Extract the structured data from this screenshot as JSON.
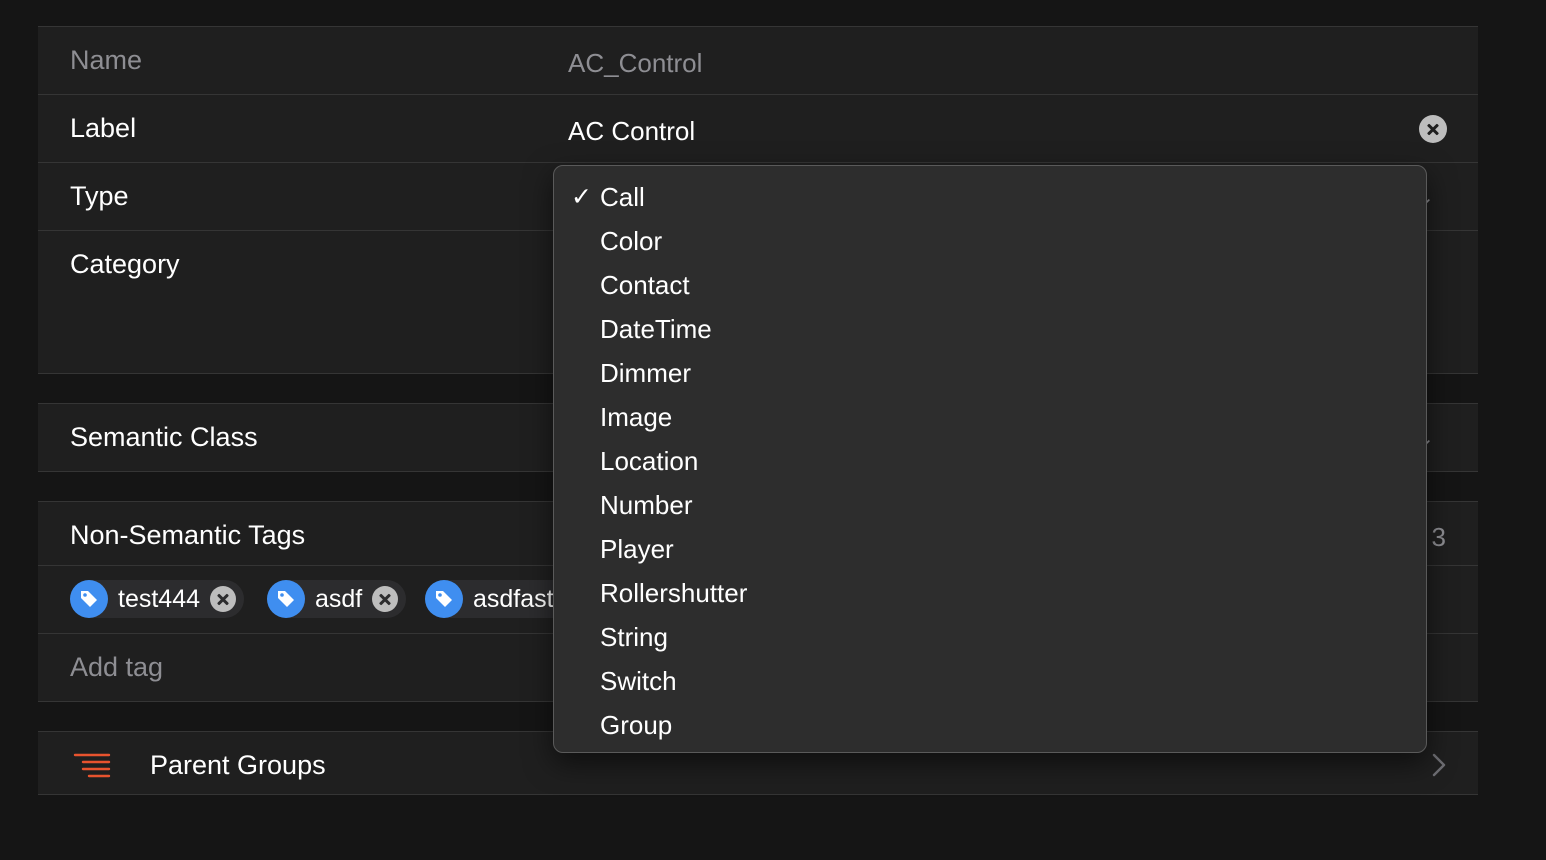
{
  "fields": {
    "name": {
      "label": "Name",
      "value": "AC_Control"
    },
    "label": {
      "label": "Label",
      "value": "AC Control"
    },
    "type": {
      "label": "Type"
    },
    "category": {
      "label": "Category"
    }
  },
  "semantic": {
    "label": "Semantic Class"
  },
  "tags": {
    "label": "Non-Semantic Tags",
    "count": "3",
    "items": [
      {
        "label": "test444"
      },
      {
        "label": "asdf"
      },
      {
        "label": "asdfast"
      }
    ],
    "add_placeholder": "Add tag"
  },
  "parent_groups": {
    "label": "Parent Groups",
    "icon": "list-indent-icon",
    "icon_color": "#e8532e"
  },
  "type_menu": {
    "selected": "Call",
    "check_glyph": "✓",
    "items": [
      "Call",
      "Color",
      "Contact",
      "DateTime",
      "Dimmer",
      "Image",
      "Location",
      "Number",
      "Player",
      "Rollershutter",
      "String",
      "Switch",
      "Group"
    ]
  },
  "colors": {
    "tag_accent": "#3f8ef0",
    "background": "#151515",
    "row_background": "#1f1f1f"
  }
}
